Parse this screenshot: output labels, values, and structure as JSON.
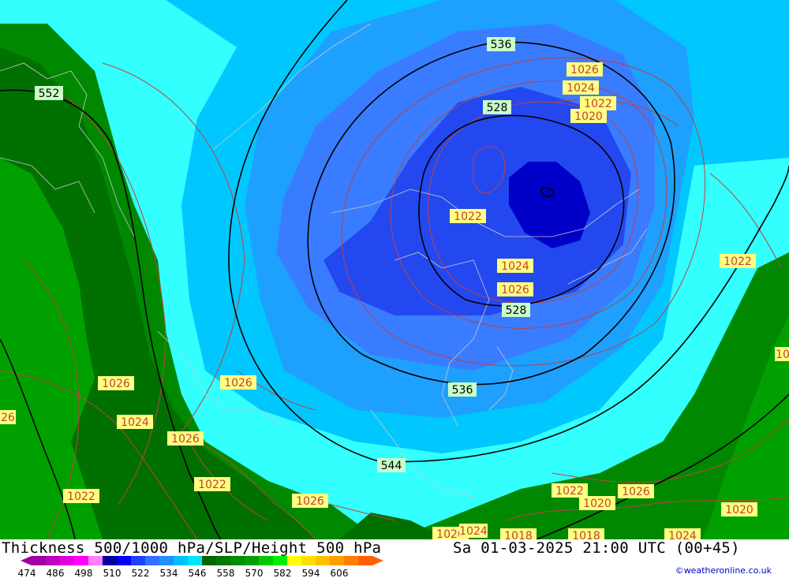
{
  "header": {
    "title_left": "Thickness 500/1000 hPa/SLP/Height 500 hPa",
    "title_right": "Sa 01-03-2025 21:00 UTC (00+45)"
  },
  "legend": {
    "ticks": [
      "474",
      "486",
      "498",
      "510",
      "522",
      "534",
      "546",
      "558",
      "570",
      "582",
      "594",
      "606"
    ],
    "colors": [
      "#a000a0",
      "#c000c0",
      "#e000e0",
      "#ff00ff",
      "#ff80ff",
      "#0000a0",
      "#0000ff",
      "#2040ff",
      "#3070ff",
      "#1e90ff",
      "#00bfff",
      "#00e5ff",
      "#006400",
      "#007800",
      "#008c00",
      "#00a000",
      "#00c800",
      "#00f000",
      "#ffff00",
      "#ffe000",
      "#ffc000",
      "#ffa000",
      "#ff8000",
      "#ff6000"
    ]
  },
  "credit": "©weatheronline.co.uk",
  "map": {
    "height_labels": [
      "536",
      "528",
      "528",
      "536",
      "544",
      "552"
    ],
    "pressure_labels": [
      "1026",
      "1024",
      "1022",
      "1020",
      "1022",
      "1024",
      "1026",
      "1022",
      "1026",
      "1026",
      "1024",
      "1026",
      "1022",
      "1022",
      "1026",
      "1022",
      "1020",
      "1026",
      "1020",
      "1026",
      "1024",
      "1018",
      "1018",
      "1024",
      "26",
      "10"
    ],
    "colors": {
      "deep_blue": "#0000c8",
      "blue": "#2448f0",
      "mid_blue": "#3a7cff",
      "light_blue": "#1ea0ff",
      "cyan": "#00c8ff",
      "light_cyan": "#33ffff",
      "dark_green": "#007000",
      "green": "#008800",
      "bright_green": "#00a000",
      "isobar": "#c04040",
      "contour": "#000000"
    }
  }
}
